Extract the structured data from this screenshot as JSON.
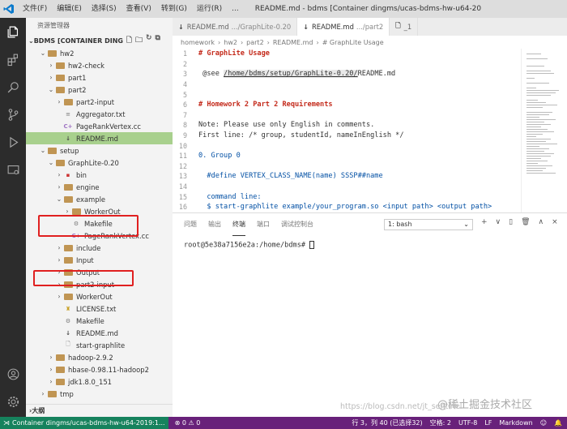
{
  "titlebar": {
    "menu": [
      "文件(F)",
      "编辑(E)",
      "选择(S)",
      "查看(V)",
      "转到(G)",
      "运行(R)",
      "..."
    ],
    "title": "README.md - bdms [Container dingms/ucas-bdms-hw-u64-2019:16.04 (/nervous_lala..."
  },
  "sidebar": {
    "title": "资源管理器",
    "workspace": "BDMS [CONTAINER DINGM...",
    "tree": [
      {
        "label": "hw2",
        "type": "folder",
        "depth": 1,
        "open": true
      },
      {
        "label": "hw2-check",
        "type": "folder",
        "depth": 2,
        "open": false
      },
      {
        "label": "part1",
        "type": "folder",
        "depth": 2,
        "open": false
      },
      {
        "label": "part2",
        "type": "folder",
        "depth": 2,
        "open": true
      },
      {
        "label": "part2-input",
        "type": "folder",
        "depth": 3,
        "open": false
      },
      {
        "label": "Aggregator.txt",
        "type": "txt",
        "depth": 3
      },
      {
        "label": "PageRankVertex.cc",
        "type": "cc",
        "depth": 3
      },
      {
        "label": "README.md",
        "type": "md",
        "depth": 3,
        "selected": true
      },
      {
        "label": "setup",
        "type": "folder",
        "depth": 1,
        "open": true
      },
      {
        "label": "GraphLite-0.20",
        "type": "folder",
        "depth": 2,
        "open": true
      },
      {
        "label": "bin",
        "type": "bin",
        "depth": 3,
        "open": false
      },
      {
        "label": "engine",
        "type": "folder",
        "depth": 3,
        "open": false
      },
      {
        "label": "example",
        "type": "folder",
        "depth": 3,
        "open": true
      },
      {
        "label": "WorkerOut",
        "type": "folder",
        "depth": 4,
        "open": false
      },
      {
        "label": "Makefile",
        "type": "make",
        "depth": 4
      },
      {
        "label": "PageRankVertex.cc",
        "type": "cc",
        "depth": 4
      },
      {
        "label": "include",
        "type": "folder",
        "depth": 3,
        "open": false
      },
      {
        "label": "Input",
        "type": "folder",
        "depth": 3,
        "open": false
      },
      {
        "label": "Output",
        "type": "folder",
        "depth": 3,
        "open": false
      },
      {
        "label": "part2-input",
        "type": "folder",
        "depth": 3,
        "open": false
      },
      {
        "label": "WorkerOut",
        "type": "folder",
        "depth": 3,
        "open": false
      },
      {
        "label": "LICENSE.txt",
        "type": "lic",
        "depth": 3
      },
      {
        "label": "Makefile",
        "type": "make",
        "depth": 3
      },
      {
        "label": "README.md",
        "type": "md",
        "depth": 3
      },
      {
        "label": "start-graphlite",
        "type": "file",
        "depth": 3
      },
      {
        "label": "hadoop-2.9.2",
        "type": "folder",
        "depth": 2,
        "open": false
      },
      {
        "label": "hbase-0.98.11-hadoop2",
        "type": "folder",
        "depth": 2,
        "open": false
      },
      {
        "label": "jdk1.8.0_151",
        "type": "folder",
        "depth": 2,
        "open": false
      },
      {
        "label": "tmp",
        "type": "folder",
        "depth": 1,
        "open": false
      }
    ],
    "outline": "大纲"
  },
  "tabs": [
    {
      "label": "README.md",
      "path": ".../GraphLite-0.20",
      "active": false
    },
    {
      "label": "README.md",
      "path": ".../part2",
      "active": true
    },
    {
      "label": "_1",
      "path": "",
      "active": false
    }
  ],
  "breadcrumb": [
    "homework",
    "›",
    "hw2",
    "›",
    "part2",
    "›",
    "README.md",
    "›",
    "# GraphLite Usage"
  ],
  "editor": {
    "lines": [
      {
        "n": "1",
        "t": "# GraphLite Usage"
      },
      {
        "n": "2",
        "t": ""
      },
      {
        "n": "3",
        "t": " @see /home/bdms/setup/GraphLite-0.20/README.md"
      },
      {
        "n": "4",
        "t": ""
      },
      {
        "n": "5",
        "t": ""
      },
      {
        "n": "6",
        "t": "# Homework 2 Part 2 Requirements"
      },
      {
        "n": "7",
        "t": ""
      },
      {
        "n": "8",
        "t": "Note: Please use only English in comments."
      },
      {
        "n": "9",
        "t": "First line: /* group, studentId, nameInEnglish */"
      },
      {
        "n": "10",
        "t": ""
      },
      {
        "n": "11",
        "t": "0. Group 0"
      },
      {
        "n": "12",
        "t": ""
      },
      {
        "n": "13",
        "t": "  #define VERTEX_CLASS_NAME(name) SSSP##name"
      },
      {
        "n": "14",
        "t": ""
      },
      {
        "n": "15",
        "t": "  command line:"
      },
      {
        "n": "16",
        "t": "  $ start-graphlite example/your_program.so <input path> <output path>"
      }
    ]
  },
  "panel": {
    "tabs": [
      "问题",
      "输出",
      "终端",
      "端口",
      "调试控制台"
    ],
    "active_tab": "终端",
    "terminal_select": "1: bash",
    "actions": [
      "+",
      "∨",
      "🗑",
      "∧",
      "×"
    ],
    "prompt": "root@5e38a7156e2a:/home/bdms# "
  },
  "watermark": {
    "url": "https://blog.csdn.net/jt_sentinel",
    "brand": "@稀土掘金技术社区"
  },
  "status": {
    "remote": "Container dingms/ucas-bdms-hw-u64-2019:1...",
    "problems": "⊗ 0 ⚠ 0",
    "position": "行 3，列 40 (已选择32)",
    "spaces": "空格: 2",
    "encoding": "UTF-8",
    "eol": "LF",
    "language": "Markdown"
  },
  "colors": {
    "statusbar": "#68217a",
    "remote": "#16825d",
    "selection": "#a8d08d",
    "highlight": "#e02020"
  }
}
